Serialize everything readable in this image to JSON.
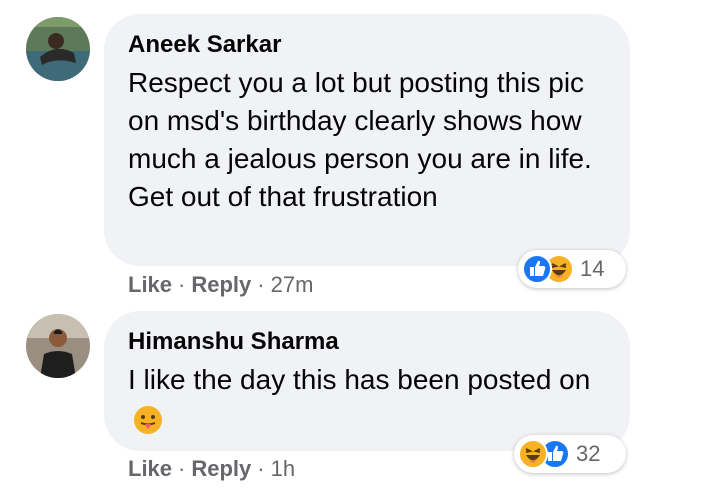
{
  "comments": [
    {
      "author": "Aneek Sarkar",
      "text": "Respect you a lot but posting this pic on msd's birthday clearly shows how much a jealous person you are in life. Get out of that frustration",
      "reaction_count": "14",
      "like_label": "Like",
      "reply_label": "Reply",
      "time": "27m",
      "reactions": [
        "like-icon",
        "haha-icon"
      ]
    },
    {
      "author": "Himanshu Sharma",
      "text": "I like the day this has been posted on",
      "emoji": "tongue-out-emoji",
      "reaction_count": "32",
      "like_label": "Like",
      "reply_label": "Reply",
      "time": "1h",
      "reactions": [
        "haha-icon",
        "like-icon"
      ]
    }
  ],
  "colors": {
    "bubble": "#f0f2f5",
    "like_blue": "#1877f2",
    "haha_yellow": "#f7b125",
    "meta_gray": "#65676b"
  },
  "separator": "·"
}
